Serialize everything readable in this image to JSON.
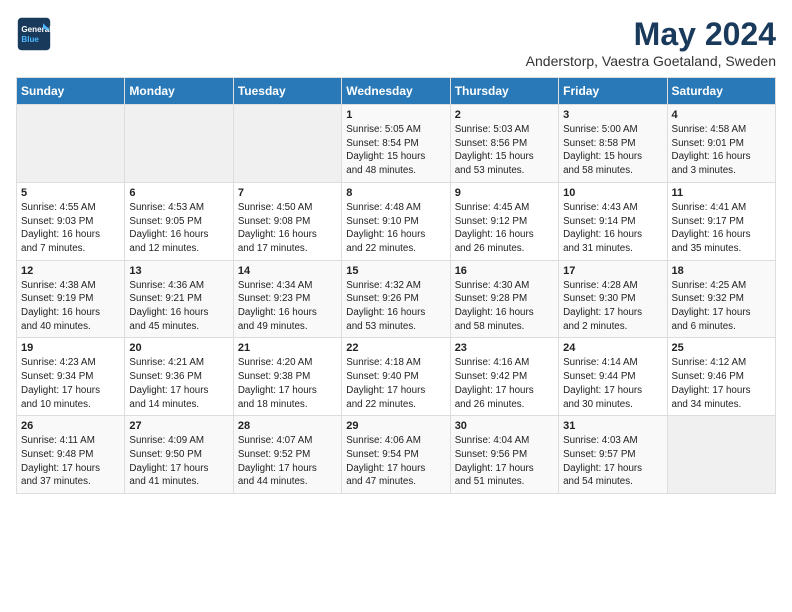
{
  "logo": {
    "line1": "General",
    "line2": "Blue"
  },
  "title": "May 2024",
  "subtitle": "Anderstorp, Vaestra Goetaland, Sweden",
  "days_of_week": [
    "Sunday",
    "Monday",
    "Tuesday",
    "Wednesday",
    "Thursday",
    "Friday",
    "Saturday"
  ],
  "weeks": [
    [
      {
        "day": "",
        "info": ""
      },
      {
        "day": "",
        "info": ""
      },
      {
        "day": "",
        "info": ""
      },
      {
        "day": "1",
        "info": "Sunrise: 5:05 AM\nSunset: 8:54 PM\nDaylight: 15 hours\nand 48 minutes."
      },
      {
        "day": "2",
        "info": "Sunrise: 5:03 AM\nSunset: 8:56 PM\nDaylight: 15 hours\nand 53 minutes."
      },
      {
        "day": "3",
        "info": "Sunrise: 5:00 AM\nSunset: 8:58 PM\nDaylight: 15 hours\nand 58 minutes."
      },
      {
        "day": "4",
        "info": "Sunrise: 4:58 AM\nSunset: 9:01 PM\nDaylight: 16 hours\nand 3 minutes."
      }
    ],
    [
      {
        "day": "5",
        "info": "Sunrise: 4:55 AM\nSunset: 9:03 PM\nDaylight: 16 hours\nand 7 minutes."
      },
      {
        "day": "6",
        "info": "Sunrise: 4:53 AM\nSunset: 9:05 PM\nDaylight: 16 hours\nand 12 minutes."
      },
      {
        "day": "7",
        "info": "Sunrise: 4:50 AM\nSunset: 9:08 PM\nDaylight: 16 hours\nand 17 minutes."
      },
      {
        "day": "8",
        "info": "Sunrise: 4:48 AM\nSunset: 9:10 PM\nDaylight: 16 hours\nand 22 minutes."
      },
      {
        "day": "9",
        "info": "Sunrise: 4:45 AM\nSunset: 9:12 PM\nDaylight: 16 hours\nand 26 minutes."
      },
      {
        "day": "10",
        "info": "Sunrise: 4:43 AM\nSunset: 9:14 PM\nDaylight: 16 hours\nand 31 minutes."
      },
      {
        "day": "11",
        "info": "Sunrise: 4:41 AM\nSunset: 9:17 PM\nDaylight: 16 hours\nand 35 minutes."
      }
    ],
    [
      {
        "day": "12",
        "info": "Sunrise: 4:38 AM\nSunset: 9:19 PM\nDaylight: 16 hours\nand 40 minutes."
      },
      {
        "day": "13",
        "info": "Sunrise: 4:36 AM\nSunset: 9:21 PM\nDaylight: 16 hours\nand 45 minutes."
      },
      {
        "day": "14",
        "info": "Sunrise: 4:34 AM\nSunset: 9:23 PM\nDaylight: 16 hours\nand 49 minutes."
      },
      {
        "day": "15",
        "info": "Sunrise: 4:32 AM\nSunset: 9:26 PM\nDaylight: 16 hours\nand 53 minutes."
      },
      {
        "day": "16",
        "info": "Sunrise: 4:30 AM\nSunset: 9:28 PM\nDaylight: 16 hours\nand 58 minutes."
      },
      {
        "day": "17",
        "info": "Sunrise: 4:28 AM\nSunset: 9:30 PM\nDaylight: 17 hours\nand 2 minutes."
      },
      {
        "day": "18",
        "info": "Sunrise: 4:25 AM\nSunset: 9:32 PM\nDaylight: 17 hours\nand 6 minutes."
      }
    ],
    [
      {
        "day": "19",
        "info": "Sunrise: 4:23 AM\nSunset: 9:34 PM\nDaylight: 17 hours\nand 10 minutes."
      },
      {
        "day": "20",
        "info": "Sunrise: 4:21 AM\nSunset: 9:36 PM\nDaylight: 17 hours\nand 14 minutes."
      },
      {
        "day": "21",
        "info": "Sunrise: 4:20 AM\nSunset: 9:38 PM\nDaylight: 17 hours\nand 18 minutes."
      },
      {
        "day": "22",
        "info": "Sunrise: 4:18 AM\nSunset: 9:40 PM\nDaylight: 17 hours\nand 22 minutes."
      },
      {
        "day": "23",
        "info": "Sunrise: 4:16 AM\nSunset: 9:42 PM\nDaylight: 17 hours\nand 26 minutes."
      },
      {
        "day": "24",
        "info": "Sunrise: 4:14 AM\nSunset: 9:44 PM\nDaylight: 17 hours\nand 30 minutes."
      },
      {
        "day": "25",
        "info": "Sunrise: 4:12 AM\nSunset: 9:46 PM\nDaylight: 17 hours\nand 34 minutes."
      }
    ],
    [
      {
        "day": "26",
        "info": "Sunrise: 4:11 AM\nSunset: 9:48 PM\nDaylight: 17 hours\nand 37 minutes."
      },
      {
        "day": "27",
        "info": "Sunrise: 4:09 AM\nSunset: 9:50 PM\nDaylight: 17 hours\nand 41 minutes."
      },
      {
        "day": "28",
        "info": "Sunrise: 4:07 AM\nSunset: 9:52 PM\nDaylight: 17 hours\nand 44 minutes."
      },
      {
        "day": "29",
        "info": "Sunrise: 4:06 AM\nSunset: 9:54 PM\nDaylight: 17 hours\nand 47 minutes."
      },
      {
        "day": "30",
        "info": "Sunrise: 4:04 AM\nSunset: 9:56 PM\nDaylight: 17 hours\nand 51 minutes."
      },
      {
        "day": "31",
        "info": "Sunrise: 4:03 AM\nSunset: 9:57 PM\nDaylight: 17 hours\nand 54 minutes."
      },
      {
        "day": "",
        "info": ""
      }
    ]
  ]
}
